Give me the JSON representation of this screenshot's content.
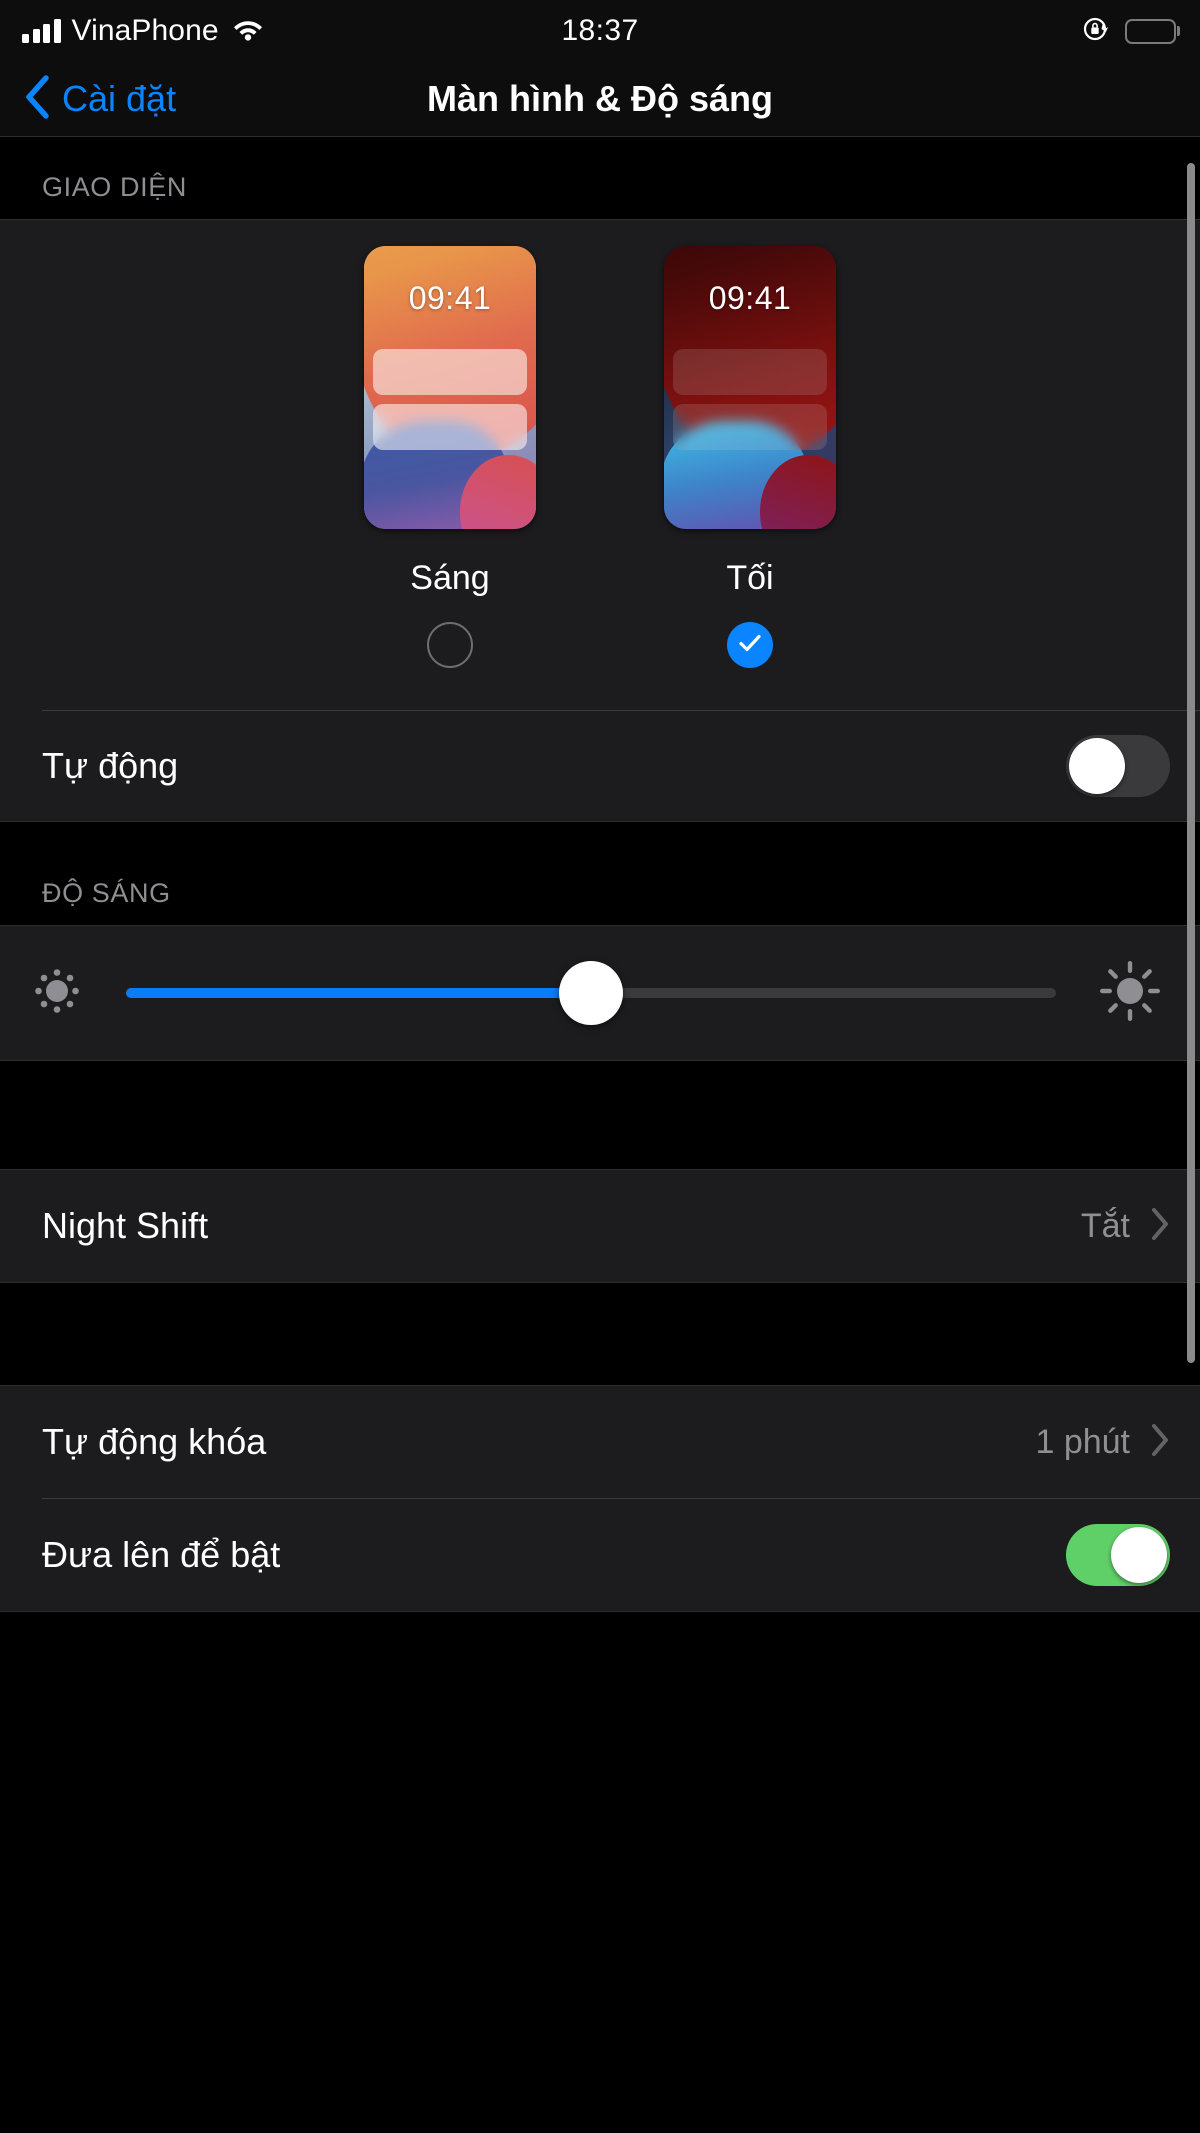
{
  "status_bar": {
    "carrier": "VinaPhone",
    "time": "18:37",
    "signal_icon": "cellular-bars-icon",
    "wifi_icon": "wifi-icon",
    "rotation_lock_icon": "rotation-lock-icon",
    "battery_icon": "battery-icon"
  },
  "nav": {
    "back_label": "Cài đặt",
    "back_icon": "chevron-left-icon",
    "title": "Màn hình & Độ sáng"
  },
  "appearance": {
    "section_header": "GIAO DIỆN",
    "light": {
      "preview_time": "09:41",
      "label": "Sáng",
      "selected": false
    },
    "dark": {
      "preview_time": "09:41",
      "label": "Tối",
      "selected": true,
      "check_icon": "checkmark-icon"
    },
    "auto_row": {
      "title": "Tự động",
      "toggle_state": "off"
    }
  },
  "brightness": {
    "section_header": "ĐỘ SÁNG",
    "low_icon": "brightness-low-icon",
    "high_icon": "brightness-high-icon",
    "value_percent": 50
  },
  "night_shift": {
    "title": "Night Shift",
    "value": "Tắt",
    "chevron_icon": "chevron-right-icon"
  },
  "display_options": {
    "auto_lock": {
      "title": "Tự động khóa",
      "value": "1 phút",
      "chevron_icon": "chevron-right-icon"
    },
    "raise_to_wake": {
      "title": "Đưa lên để bật",
      "toggle_state": "on"
    }
  },
  "colors": {
    "accent_blue": "#0a84ff",
    "toggle_on_green": "#5fd068",
    "slider_blue": "#0a7cf5",
    "group_bg": "#1c1c1e",
    "page_bg": "#000000",
    "secondary_text": "#8e8e93"
  }
}
